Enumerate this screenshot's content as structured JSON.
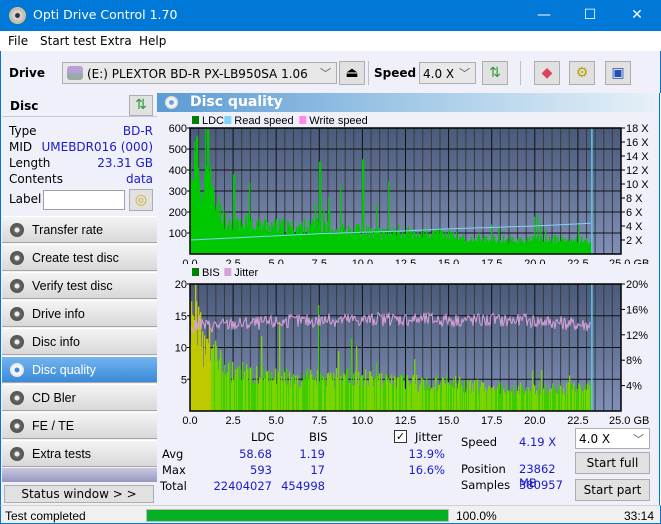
{
  "window": {
    "title": "Opti Drive Control 1.70",
    "minimize_glyph": "—",
    "maximize_glyph": "☐",
    "close_glyph": "✕"
  },
  "menu": [
    "File",
    "Start test",
    "Extra",
    "Help"
  ],
  "toolbar": {
    "drive_label": "Drive",
    "drive_value": "(E:)  PLEXTOR BD-R  PX-LB950SA 1.06",
    "speed_label": "Speed",
    "speed_value": "4.0 X",
    "icons": [
      "eject-icon",
      "refresh-icon",
      "erase-icon",
      "settings-icon",
      "save-icon"
    ]
  },
  "disc": {
    "header": "Disc",
    "rows": [
      {
        "key": "Type",
        "value": "BD-R"
      },
      {
        "key": "MID",
        "value": "UMEBDR016 (000)"
      },
      {
        "key": "Length",
        "value": "23.31 GB"
      },
      {
        "key": "Contents",
        "value": "data"
      }
    ],
    "label_key": "Label",
    "label_value": ""
  },
  "nav": [
    {
      "label": "Transfer rate",
      "active": false
    },
    {
      "label": "Create test disc",
      "active": false
    },
    {
      "label": "Verify test disc",
      "active": false
    },
    {
      "label": "Drive info",
      "active": false
    },
    {
      "label": "Disc info",
      "active": false
    },
    {
      "label": "Disc quality",
      "active": true
    },
    {
      "label": "CD Bler",
      "active": false
    },
    {
      "label": "FE / TE",
      "active": false
    },
    {
      "label": "Extra tests",
      "active": false
    }
  ],
  "status_window_label": "Status window > >",
  "panel_title": "Disc quality",
  "colors": {
    "ldc": "#00c800",
    "read_speed": "#7fd4f8",
    "write_speed": "#ff88e8",
    "bis": "#7ad400",
    "jitter": "#d8a0d8",
    "plot_bg_top": "#4a5a7a",
    "plot_bg_bottom": "#8090b8",
    "accent": "#0078d7"
  },
  "chart_data": [
    {
      "type": "area",
      "title": "LDC",
      "legend": [
        "LDC",
        "Read speed",
        "Write speed"
      ],
      "legend_position": "top-left",
      "xlabel": "GB",
      "xlim": [
        0,
        25
      ],
      "x_ticks": [
        "0.0",
        "2.5",
        "5.0",
        "7.5",
        "10.0",
        "12.5",
        "15.0",
        "17.5",
        "20.0",
        "22.5",
        "25.0 GB"
      ],
      "ylim": [
        0,
        600
      ],
      "y_ticks": [
        "100",
        "200",
        "300",
        "400",
        "500",
        "600"
      ],
      "y2lim": [
        0,
        18
      ],
      "y2_ticks": [
        "2 X",
        "4 X",
        "6 X",
        "8 X",
        "10 X",
        "12 X",
        "14 X",
        "16 X",
        "18 X"
      ],
      "grid": true,
      "data_end_gb": 23.31,
      "series": [
        {
          "name": "LDC",
          "x": [
            0.0,
            0.25,
            0.5,
            0.75,
            1.0,
            1.25,
            1.5,
            1.75,
            2.0,
            2.5,
            3.0,
            4.0,
            5.0,
            6.0,
            7.0,
            7.5,
            8.0,
            9.0,
            10.0,
            11.0,
            12.0,
            12.5,
            13.0,
            14.0,
            15.0,
            16.0,
            17.0,
            18.0,
            19.0,
            20.0,
            21.0,
            22.0,
            23.0,
            23.31
          ],
          "values": [
            450,
            520,
            480,
            310,
            590,
            300,
            270,
            240,
            180,
            170,
            175,
            160,
            150,
            145,
            150,
            150,
            140,
            135,
            130,
            110,
            130,
            115,
            120,
            110,
            110,
            80,
            75,
            80,
            75,
            75,
            80,
            70,
            75,
            70
          ]
        },
        {
          "name": "Read speed",
          "x": [
            0.0,
            2.5,
            5.0,
            7.5,
            10.0,
            12.5,
            15.0,
            17.5,
            20.0,
            22.5,
            23.31
          ],
          "values": [
            2.0,
            2.3,
            2.6,
            2.9,
            3.1,
            3.3,
            3.6,
            3.8,
            4.0,
            4.3,
            4.4
          ]
        },
        {
          "name": "Write speed",
          "x": [],
          "values": []
        }
      ],
      "peaks": [
        {
          "x": 1.0,
          "value": 593
        },
        {
          "x": 0.4,
          "value": 560
        },
        {
          "x": 10.0,
          "value": 450
        },
        {
          "x": 7.5,
          "value": 440
        },
        {
          "x": 2.5,
          "value": 380
        }
      ]
    },
    {
      "type": "area",
      "title": "BIS / Jitter",
      "legend": [
        "BIS",
        "Jitter"
      ],
      "legend_position": "top-left",
      "xlabel": "GB",
      "xlim": [
        0,
        25
      ],
      "x_ticks": [
        "0.0",
        "2.5",
        "5.0",
        "7.5",
        "10.0",
        "12.5",
        "15.0",
        "17.5",
        "20.0",
        "22.5",
        "25.0 GB"
      ],
      "ylim": [
        0,
        20
      ],
      "y_ticks": [
        "5",
        "10",
        "15",
        "20"
      ],
      "y2lim": [
        0,
        20
      ],
      "y2_ticks": [
        "4%",
        "8%",
        "12%",
        "16%",
        "20%"
      ],
      "grid": true,
      "data_end_gb": 23.31,
      "series": [
        {
          "name": "BIS",
          "x": [
            0.0,
            0.25,
            0.5,
            0.75,
            1.0,
            1.5,
            2.0,
            3.0,
            5.0,
            7.5,
            10.0,
            12.5,
            15.0,
            17.5,
            20.0,
            22.5,
            23.31
          ],
          "values": [
            16,
            17,
            15,
            11,
            12,
            10,
            7,
            7,
            6,
            6,
            6,
            5,
            5,
            4,
            4,
            4,
            5
          ]
        },
        {
          "name": "Jitter",
          "x": [
            0.0,
            0.5,
            1.0,
            2.5,
            5.0,
            7.5,
            10.0,
            12.5,
            15.0,
            17.5,
            20.0,
            22.5,
            23.31
          ],
          "values": [
            12.6,
            13.8,
            13.4,
            13.7,
            14.0,
            14.3,
            14.4,
            14.5,
            14.4,
            14.3,
            14.2,
            13.6,
            13.5
          ]
        }
      ]
    }
  ],
  "stats": {
    "col_ldc": "LDC",
    "col_bis": "BIS",
    "jitter_label": "Jitter",
    "jitter_checked": true,
    "rows": [
      {
        "label": "Avg",
        "ldc": "58.68",
        "bis": "1.19",
        "jitter": "13.9%"
      },
      {
        "label": "Max",
        "ldc": "593",
        "bis": "17",
        "jitter": "16.6%"
      },
      {
        "label": "Total",
        "ldc": "22404027",
        "bis": "454998",
        "jitter": ""
      }
    ],
    "speed_label": "Speed",
    "speed_value": "4.19 X",
    "position_label": "Position",
    "position_value": "23862 MB",
    "samples_label": "Samples",
    "samples_value": "380957",
    "speed_select": "4.0 X",
    "start_full": "Start full",
    "start_part": "Start part"
  },
  "statusbar": {
    "text": "Test completed",
    "progress": 1.0,
    "percent": "100.0%",
    "time": "33:14"
  }
}
